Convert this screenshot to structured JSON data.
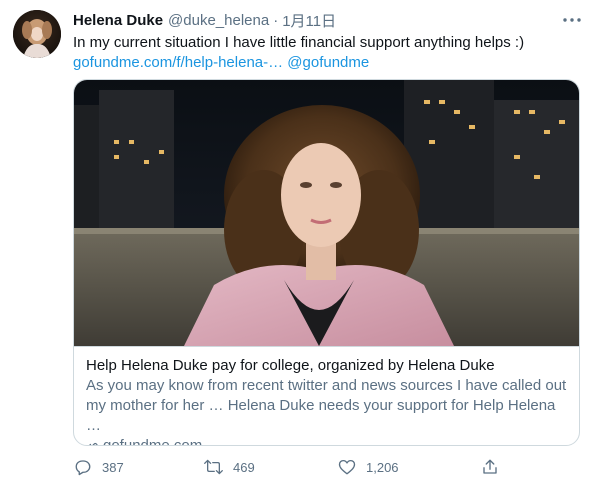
{
  "tweet": {
    "author_name": "Helena Duke",
    "handle": "@duke_helena",
    "separator": "·",
    "date": "1月11日",
    "text": "In my current situation I have little financial support anything helps :)",
    "link_text": "gofundme.com/f/help-helena-…",
    "mention": "@gofundme"
  },
  "card": {
    "title": "Help Helena Duke pay for college, organized by Helena Duke",
    "description": "As you may know from recent twitter and news sources I have called out my mother for her … Helena Duke needs your support for Help Helena …",
    "domain": "gofundme.com"
  },
  "actions": {
    "reply_count": "387",
    "retweet_count": "469",
    "like_count": "1,206"
  },
  "colors": {
    "text_primary": "#0f1419",
    "text_secondary": "#5b7083",
    "link": "#1b95e0",
    "border": "#cfd9de"
  },
  "icons": {
    "more": "more-horizontal-icon",
    "link": "link-icon",
    "reply": "reply-icon",
    "retweet": "retweet-icon",
    "like": "heart-icon",
    "share": "share-icon"
  }
}
